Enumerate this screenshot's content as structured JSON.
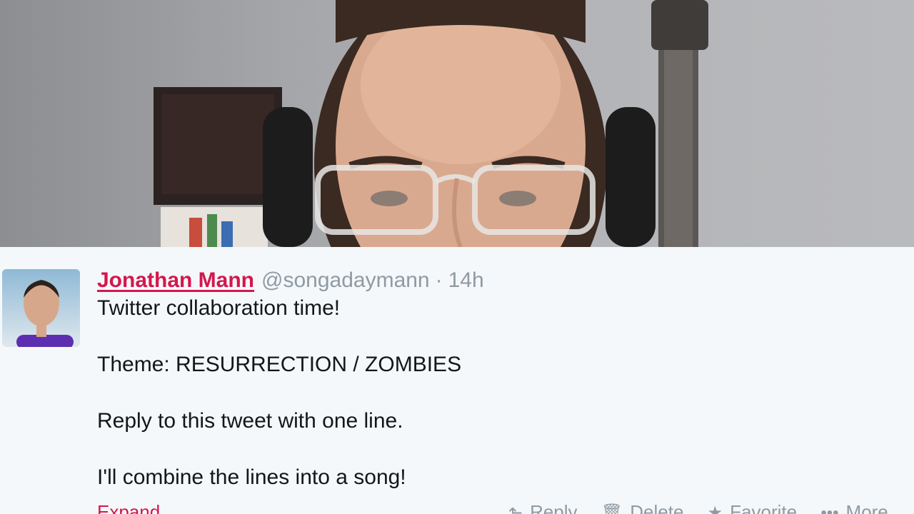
{
  "tweet": {
    "fullname": "Jonathan Mann",
    "handle": "@songadaymann",
    "separator": "·",
    "time": "14h",
    "lines": [
      "Twitter collaboration time!",
      "Theme: RESURRECTION / ZOMBIES",
      "Reply to this tweet with one line.",
      "I'll combine the lines into a song!"
    ],
    "expand_label": "Expand"
  },
  "actions": [
    {
      "label": "Reply",
      "icon": "reply-icon",
      "glyph": "⬑"
    },
    {
      "label": "Delete",
      "icon": "trash-icon",
      "glyph": "🗑"
    },
    {
      "label": "Favorite",
      "icon": "star-icon",
      "glyph": "★"
    },
    {
      "label": "More",
      "icon": "more-icon",
      "glyph": "•••"
    }
  ],
  "colors": {
    "accent": "#d4174c",
    "muted": "#8f9aa3",
    "text": "#14171a",
    "background": "#f5f8fa"
  }
}
